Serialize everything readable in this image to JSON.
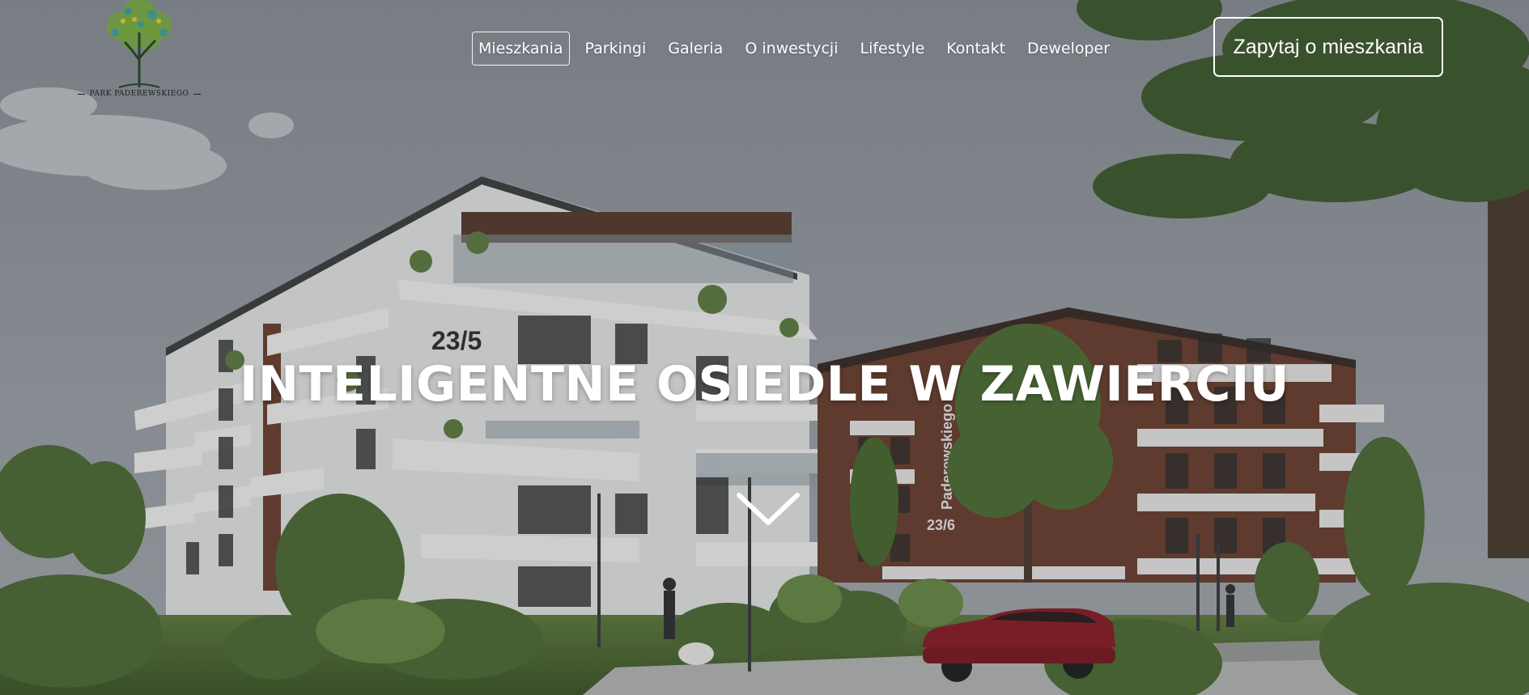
{
  "brand": {
    "name": "PARK PADEREWSKIEGO",
    "icon": "tree-logo-icon"
  },
  "nav": {
    "items": [
      {
        "label": "Mieszkania",
        "active": true
      },
      {
        "label": "Parkingi",
        "active": false
      },
      {
        "label": "Galeria",
        "active": false
      },
      {
        "label": "O inwestycji",
        "active": false
      },
      {
        "label": "Lifestyle",
        "active": false
      },
      {
        "label": "Kontakt",
        "active": false
      },
      {
        "label": "Deweloper",
        "active": false
      }
    ]
  },
  "cta": {
    "label": "Zapytaj o mieszkania"
  },
  "hero": {
    "headline": "INTELIGENTNE OSIEDLE W ZAWIERCIU",
    "scroll_icon": "chevron-down-icon",
    "building_signs": [
      "23/5",
      "Paderewskiego",
      "23/6"
    ]
  },
  "colors": {
    "text": "#ffffff",
    "facade_brown": "#6b3f2e",
    "car_red": "#8b1c24",
    "sky": "#8f959c"
  }
}
